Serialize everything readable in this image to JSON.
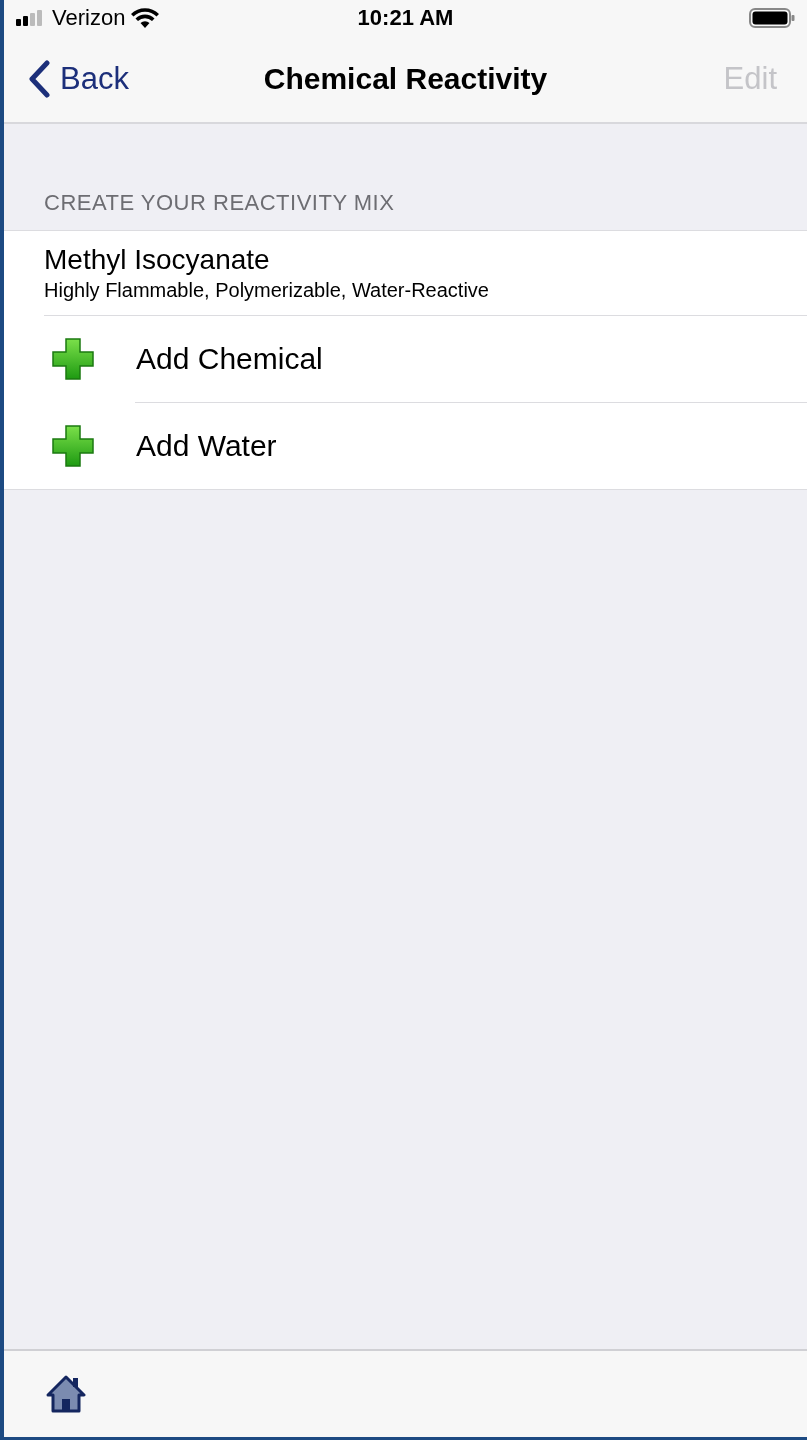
{
  "status_bar": {
    "carrier": "Verizon",
    "time": "10:21 AM"
  },
  "nav_bar": {
    "back": "Back",
    "title": "Chemical Reactivity",
    "edit": {
      "label": "Edit",
      "disabled": true
    }
  },
  "section": {
    "header": "CREATE YOUR REACTIVITY MIX",
    "rows": [
      {
        "kind": "chemical",
        "name": "Methyl Isocyanate",
        "hazards": "Highly Flammable, Polymerizable, Water-Reactive"
      },
      {
        "kind": "add",
        "label": "Add Chemical"
      },
      {
        "kind": "add",
        "label": "Add Water"
      }
    ]
  }
}
